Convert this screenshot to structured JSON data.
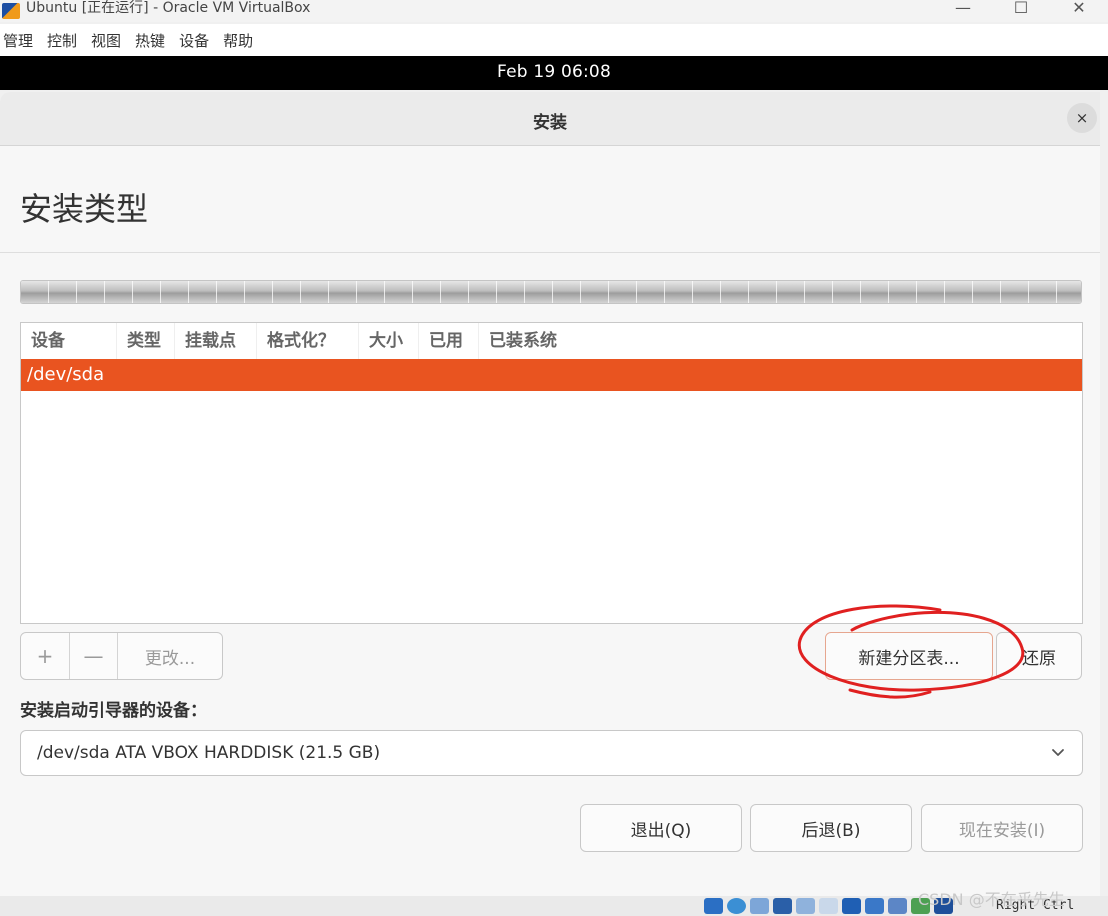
{
  "vbox": {
    "window_title": "Ubuntu [正在运行] - Oracle VM VirtualBox",
    "controls": {
      "minimize": "—",
      "maximize": "☐",
      "close": "✕"
    },
    "menu": [
      "管理",
      "控制",
      "视图",
      "热键",
      "设备",
      "帮助"
    ],
    "host_key": "Right Ctrl",
    "status_icons": [
      "hard-disk-icon",
      "optical-drive-icon",
      "audio-icon",
      "network-icon",
      "usb-icon",
      "shared-folder-icon",
      "display-icon",
      "video-capture-icon",
      "virtualization-icon",
      "mouse-integration-icon",
      "keyboard-icon"
    ]
  },
  "ubuntu_panel": {
    "clock": "Feb 19  06:08"
  },
  "installer": {
    "window_title": "安装",
    "close_icon": "×",
    "page_heading": "安装类型",
    "partition_table": {
      "columns": [
        "设备",
        "类型",
        "挂载点",
        "格式化？",
        "大小",
        "已用",
        "已装系统"
      ],
      "rows": [
        {
          "device": "/dev/sda"
        }
      ],
      "selected_color": "#e95420"
    },
    "buttons": {
      "add": "+",
      "remove": "—",
      "change": "更改...",
      "new_partition_table": "新建分区表...",
      "revert": "还原",
      "quit": "退出(Q)",
      "back": "后退(B)",
      "install_now": "现在安装(I)"
    },
    "bootloader": {
      "label": "安装启动引导器的设备：",
      "selected": "/dev/sda ATA VBOX HARDDISK (21.5 GB)"
    }
  },
  "annotation_color": "#e02020",
  "watermark": "CSDN @不在乎先生"
}
